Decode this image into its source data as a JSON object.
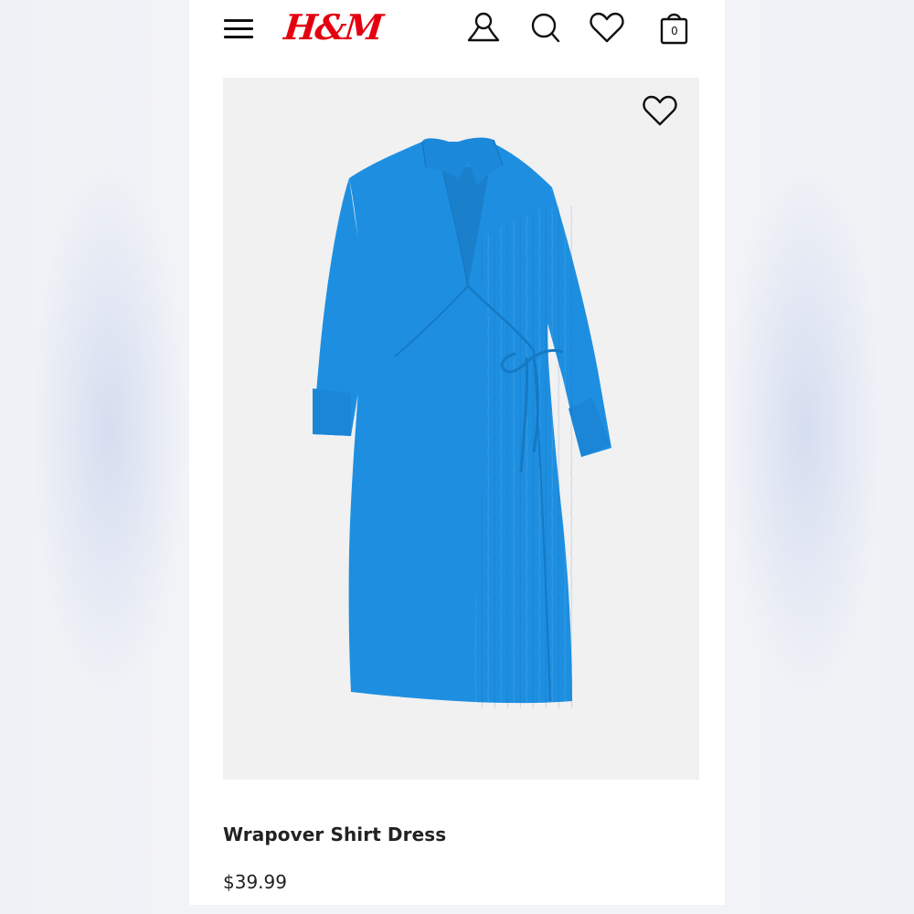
{
  "header": {
    "brand": "H&M",
    "menu_icon": "hamburger-menu-icon",
    "account_icon": "user-icon",
    "search_icon": "search-icon",
    "favorites_icon": "heart-icon",
    "bag_icon": "shopping-bag-icon",
    "bag_count": "0"
  },
  "product": {
    "image": "blue-wrap-dress",
    "favorite_icon": "heart-icon",
    "name": "Wrapover Shirt Dress",
    "price": "$39.99"
  },
  "colors": {
    "brand_red": "#e50010",
    "dress_blue": "#1e8fe0",
    "image_background": "#f1f1f1"
  }
}
